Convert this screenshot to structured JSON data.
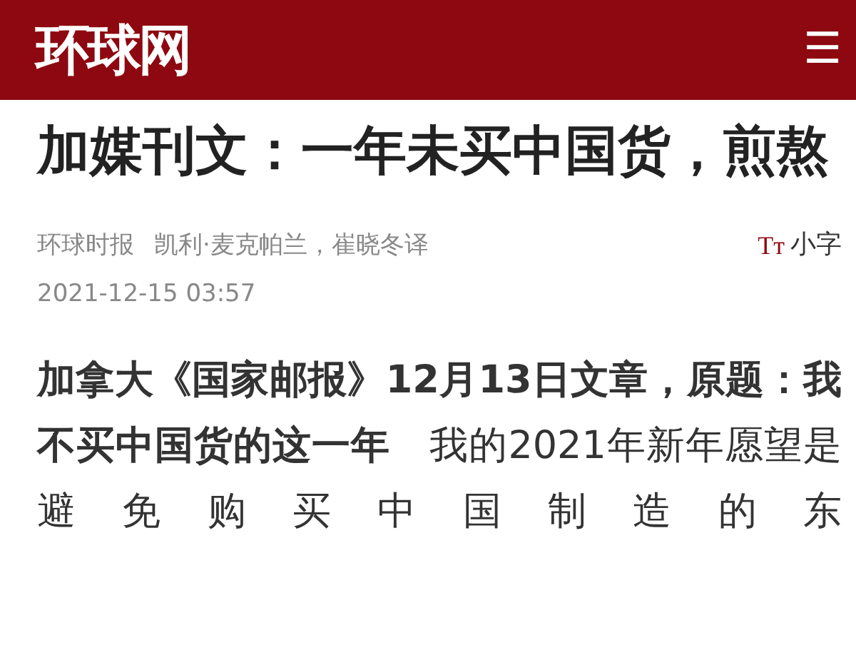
{
  "header": {
    "logo": "环球网",
    "menu_icon": "☰"
  },
  "article": {
    "title": "加媒刊文：一年未买中国货，煎熬",
    "source": "环球时报",
    "author": "凯利·麦克帕兰，崔晓冬译",
    "font_toggle": {
      "icon": "Tт",
      "label": "小字"
    },
    "date": "2021-12-15 03:57",
    "body": "**加拿大《国家邮报》12月13日文章，原题：我不买中国货的这一年**　我的2021年新年愿望是避免购买中国制造的东"
  }
}
